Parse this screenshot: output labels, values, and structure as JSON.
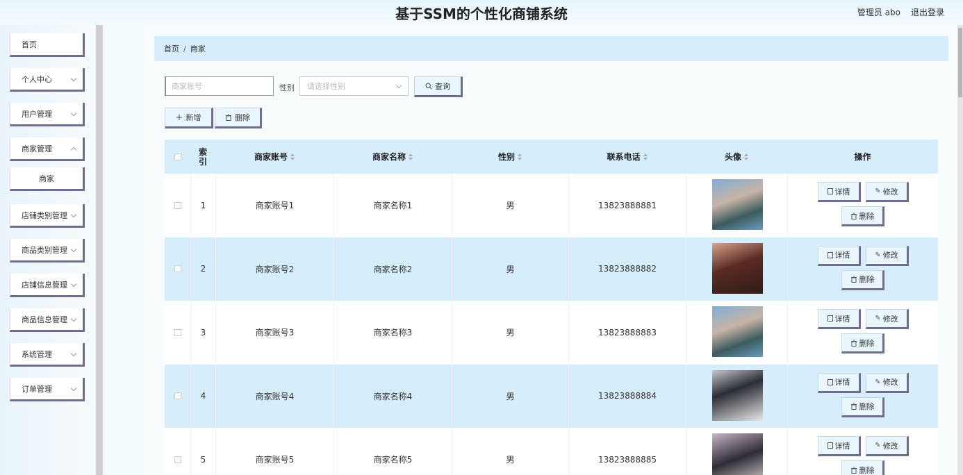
{
  "header": {
    "title": "基于SSM的个性化商铺系统",
    "user": "管理员 abo",
    "logout": "退出登录"
  },
  "sidebar": {
    "items": [
      {
        "label": "首页",
        "has_arrow": false
      },
      {
        "label": "个人中心",
        "has_arrow": true
      },
      {
        "label": "用户管理",
        "has_arrow": true
      },
      {
        "label": "商家管理",
        "has_arrow": true
      },
      {
        "label": "商家",
        "has_arrow": false,
        "sub": true
      },
      {
        "label": "店铺类别管理",
        "has_arrow": true
      },
      {
        "label": "商品类别管理",
        "has_arrow": true
      },
      {
        "label": "店铺信息管理",
        "has_arrow": true
      },
      {
        "label": "商品信息管理",
        "has_arrow": true
      },
      {
        "label": "系统管理",
        "has_arrow": true
      },
      {
        "label": "订单管理",
        "has_arrow": true
      }
    ]
  },
  "breadcrumb": {
    "home": "首页",
    "sep": "/",
    "current": "商家"
  },
  "search": {
    "account_placeholder": "商家账号",
    "gender_label": "性别",
    "gender_placeholder": "请选择性别",
    "query_label": "查询",
    "add_label": "新增",
    "delete_label": "删除"
  },
  "table": {
    "columns": {
      "index": "索引",
      "account": "商家账号",
      "name": "商家名称",
      "gender": "性别",
      "phone": "联系电话",
      "avatar": "头像",
      "actions": "操作"
    },
    "rows": [
      {
        "index": "1",
        "account": "商家账号1",
        "name": "商家名称1",
        "gender": "男",
        "phone": "13823888881"
      },
      {
        "index": "2",
        "account": "商家账号2",
        "name": "商家名称2",
        "gender": "男",
        "phone": "13823888882"
      },
      {
        "index": "3",
        "account": "商家账号3",
        "name": "商家名称3",
        "gender": "男",
        "phone": "13823888883"
      },
      {
        "index": "4",
        "account": "商家账号4",
        "name": "商家名称4",
        "gender": "男",
        "phone": "13823888884"
      },
      {
        "index": "5",
        "account": "商家账号5",
        "name": "商家名称5",
        "gender": "男",
        "phone": "13823888885"
      }
    ],
    "action_labels": {
      "detail": "详情",
      "edit": "修改",
      "delete": "删除"
    }
  }
}
